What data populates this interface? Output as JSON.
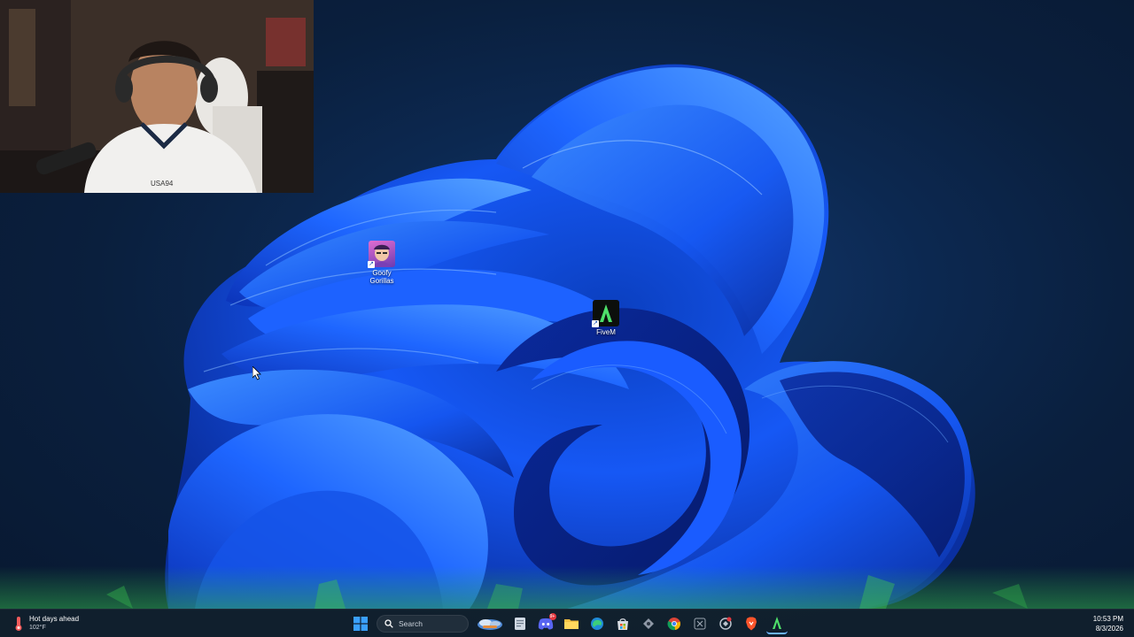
{
  "desktop": {
    "icons": [
      {
        "label_line1": "Goofy",
        "label_line2": "Gorillas",
        "icon": "goofy-gorillas-app-icon"
      },
      {
        "label_line1": "FiveM",
        "label_line2": "",
        "icon": "fivem-app-icon"
      }
    ]
  },
  "taskbar": {
    "weather": {
      "headline": "Hot days ahead",
      "temperature": "102°F",
      "icon": "thermometer-icon"
    },
    "search": {
      "placeholder": "Search"
    },
    "pinned": [
      "start-windows-icon",
      "search-icon",
      "widgets-icon",
      "file-icon",
      "discord-icon",
      "file-explorer-icon",
      "edge-icon",
      "store-icon",
      "app-icon",
      "chrome-icon",
      "app-x-icon",
      "app-circle-icon",
      "brave-icon",
      "fivem-taskbar-icon"
    ],
    "discord_badge": "9+",
    "clock": {
      "time": "10:53 PM",
      "date": "8/3/2026"
    }
  },
  "colors": {
    "wallpaper_bg": "#0a1f3d",
    "bloom_blue": "#1d5cff",
    "taskbar_bg": "#12202c",
    "glow_green": "#2fa84a"
  }
}
